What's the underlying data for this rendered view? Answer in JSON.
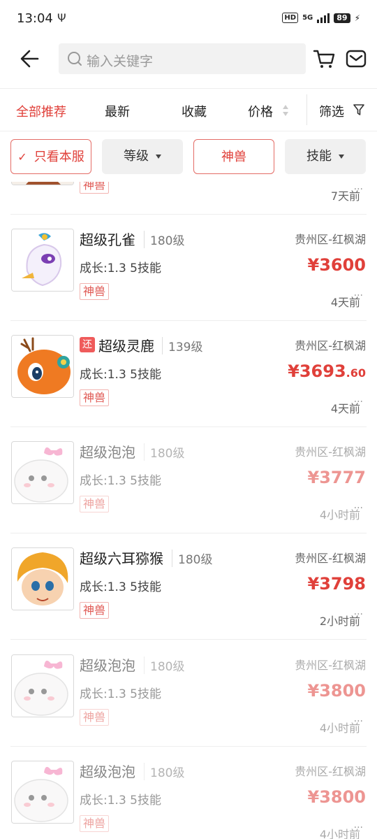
{
  "status": {
    "time": "13:04",
    "usb_icon": "usb-icon",
    "hd": "HD",
    "network": "5G",
    "battery": "89"
  },
  "header": {
    "search_placeholder": "输入关键字"
  },
  "tabs": [
    {
      "label": "全部推荐"
    },
    {
      "label": "最新"
    },
    {
      "label": "收藏"
    },
    {
      "label": "价格"
    },
    {
      "label": "筛选"
    }
  ],
  "chips": [
    {
      "label": "只看本服"
    },
    {
      "label": "等级"
    },
    {
      "label": "神兽"
    },
    {
      "label": "技能"
    }
  ],
  "colors": {
    "accent": "#e0403a"
  },
  "items": [
    {
      "name": "",
      "level": "",
      "growth": "",
      "tag": "神兽",
      "region": "",
      "price": "",
      "cents": "",
      "time": "7天前"
    },
    {
      "name": "超级孔雀",
      "level": "180级",
      "growth": "成长:1.3 5技能",
      "tag": "神兽",
      "region": "贵州区-红枫湖",
      "price": "¥3600",
      "cents": "",
      "time": "4天前"
    },
    {
      "name": "超级灵鹿",
      "level": "139级",
      "badge": "还",
      "growth": "成长:1.3 5技能",
      "tag": "神兽",
      "region": "贵州区-红枫湖",
      "price": "¥3693",
      "cents": ".60",
      "time": "4天前"
    },
    {
      "name": "超级泡泡",
      "level": "180级",
      "growth": "成长:1.3 5技能",
      "tag": "神兽",
      "region": "贵州区-红枫湖",
      "price": "¥3777",
      "cents": "",
      "time": "4小时前"
    },
    {
      "name": "超级六耳猕猴",
      "level": "180级",
      "growth": "成长:1.3 5技能",
      "tag": "神兽",
      "region": "贵州区-红枫湖",
      "price": "¥3798",
      "cents": "",
      "time": "2小时前"
    },
    {
      "name": "超级泡泡",
      "level": "180级",
      "growth": "成长:1.3 5技能",
      "tag": "神兽",
      "region": "贵州区-红枫湖",
      "price": "¥3800",
      "cents": "",
      "time": "4小时前"
    },
    {
      "name": "超级泡泡",
      "level": "180级",
      "growth": "成长:1.3 5技能",
      "tag": "神兽",
      "region": "贵州区-红枫湖",
      "price": "¥3800",
      "cents": "",
      "time": "4小时前"
    }
  ]
}
